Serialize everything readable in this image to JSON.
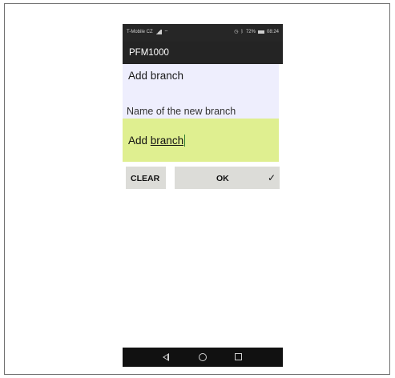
{
  "status_bar": {
    "carrier": "T-Mobile CZ",
    "battery": "72%",
    "time": "08:24"
  },
  "app": {
    "title": "PFM1000"
  },
  "dialog": {
    "title": "Add branch",
    "prompt": "Name of the new branch",
    "input_word1": "Add",
    "input_word2": "branch",
    "clear_label": "CLEAR",
    "ok_label": "OK",
    "ok_check": "✓"
  },
  "colors": {
    "dialog_bg": "#eeeefd",
    "input_bg": "#dfef90",
    "button_bg": "#dcdcd8",
    "bar_bg": "#242424"
  },
  "icons": [
    "signal-icon",
    "wifi-icon",
    "alarm-icon",
    "bluetooth-icon",
    "battery-icon",
    "back-icon",
    "home-icon",
    "recents-icon",
    "check-icon"
  ]
}
